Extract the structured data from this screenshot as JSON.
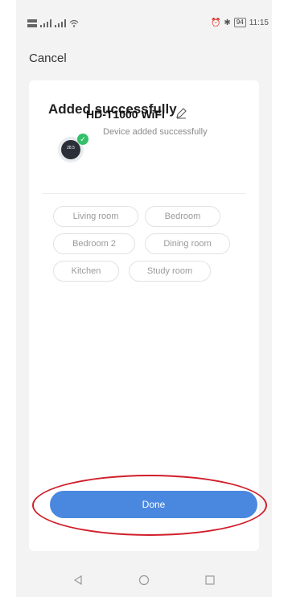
{
  "status_bar": {
    "time": "11:15",
    "battery": "94"
  },
  "cancel_label": "Cancel",
  "card": {
    "title": "Added successfully",
    "device": {
      "icon_text": "28.5",
      "name": "HD-T1000 WiFi",
      "status": "Device added successfully"
    },
    "rooms": [
      "Living room",
      "Bedroom",
      "Bedroom 2",
      "Dining room",
      "Kitchen",
      "Study room"
    ],
    "done_label": "Done"
  },
  "colors": {
    "primary_button": "#4a88e0",
    "success_badge": "#33c06a",
    "highlight_annotation": "#d11e2a"
  },
  "icons": [
    "signal-icon",
    "wifi-icon",
    "alarm-icon",
    "bluetooth-icon",
    "battery-icon",
    "check-icon",
    "pencil-icon",
    "back-icon",
    "home-icon",
    "recents-icon"
  ]
}
